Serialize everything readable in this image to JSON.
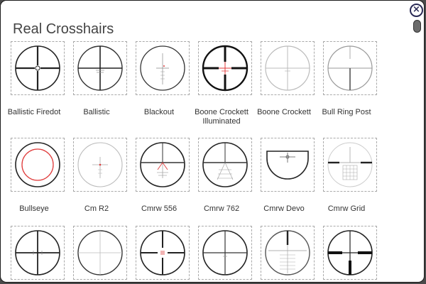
{
  "header": {
    "title": "Real Crosshairs",
    "close_label": "×"
  },
  "crosshairs": [
    {
      "label": "Ballistic Firedot",
      "icon": "ballistic-firedot-reticle-icon"
    },
    {
      "label": "Ballistic",
      "icon": "ballistic-reticle-icon"
    },
    {
      "label": "Blackout",
      "icon": "blackout-reticle-icon"
    },
    {
      "label": "Boone Crockett Illuminated",
      "icon": "boone-crockett-illuminated-reticle-icon"
    },
    {
      "label": "Boone Crockett",
      "icon": "boone-crockett-reticle-icon"
    },
    {
      "label": "Bull Ring Post",
      "icon": "bull-ring-post-reticle-icon"
    },
    {
      "label": "Bullseye",
      "icon": "bullseye-reticle-icon"
    },
    {
      "label": "Cm R2",
      "icon": "cm-r2-reticle-icon"
    },
    {
      "label": "Cmrw 556",
      "icon": "cmrw-556-reticle-icon"
    },
    {
      "label": "Cmrw 762",
      "icon": "cmrw-762-reticle-icon"
    },
    {
      "label": "Cmrw Devo",
      "icon": "cmrw-devo-reticle-icon"
    },
    {
      "label": "Cmrw Grid",
      "icon": "cmrw-grid-reticle-icon"
    },
    {
      "label": "",
      "icon": "duplex-reticle-icon"
    },
    {
      "label": "",
      "icon": "fine-crosshair-reticle-icon"
    },
    {
      "label": "",
      "icon": "red-dot-crosshair-reticle-icon"
    },
    {
      "label": "",
      "icon": "mildot-reticle-icon"
    },
    {
      "label": "",
      "icon": "christmas-tree-reticle-icon"
    },
    {
      "label": "",
      "icon": "heavy-duplex-reticle-icon"
    }
  ],
  "colors": {
    "accent_red": "#e03a3a",
    "border": "#a9a9a9",
    "text": "#333333",
    "close": "#2a2a55"
  }
}
